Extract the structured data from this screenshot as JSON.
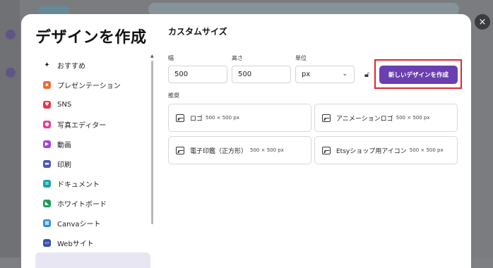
{
  "modal": {
    "title": "デザインを作成",
    "close_icon": "×"
  },
  "sidebar": {
    "items": [
      {
        "label": "おすすめ",
        "icon": "sparkle-icon",
        "color": "#222222"
      },
      {
        "label": "プレゼンテーション",
        "icon": "presentation-icon",
        "color": "#ee6a35"
      },
      {
        "label": "SNS",
        "icon": "heart-icon",
        "color": "#e6364f"
      },
      {
        "label": "写真エディター",
        "icon": "camera-icon",
        "color": "#e8408a"
      },
      {
        "label": "動画",
        "icon": "video-icon",
        "color": "#a642d8"
      },
      {
        "label": "印刷",
        "icon": "printer-icon",
        "color": "#4a56b8"
      },
      {
        "label": "ドキュメント",
        "icon": "document-icon",
        "color": "#1aa3a3"
      },
      {
        "label": "ホワイトボード",
        "icon": "whiteboard-icon",
        "color": "#1c9e55"
      },
      {
        "label": "Canvaシート",
        "icon": "sheet-icon",
        "color": "#2d8ae0"
      },
      {
        "label": "Webサイト",
        "icon": "website-icon",
        "color": "#3b4ea8"
      }
    ]
  },
  "custom": {
    "title": "カスタムサイズ",
    "width_label": "幅",
    "width_value": "500",
    "height_label": "高さ",
    "height_value": "500",
    "unit_label": "単位",
    "unit_value": "px",
    "create_button": "新しいデザインを作成"
  },
  "recommended": {
    "label": "推奨",
    "cards": [
      {
        "name": "ロゴ",
        "size": "500 × 500 px"
      },
      {
        "name": "アニメーションロゴ",
        "size": "500 × 500 px"
      },
      {
        "name": "電子印鑑（正方形）",
        "size": "500 × 500 px"
      },
      {
        "name": "Etsyショップ用アイコン",
        "size": "500 × 500 px"
      }
    ]
  },
  "colors": {
    "accent": "#6a3fb0",
    "highlight_border": "#e0262d"
  }
}
